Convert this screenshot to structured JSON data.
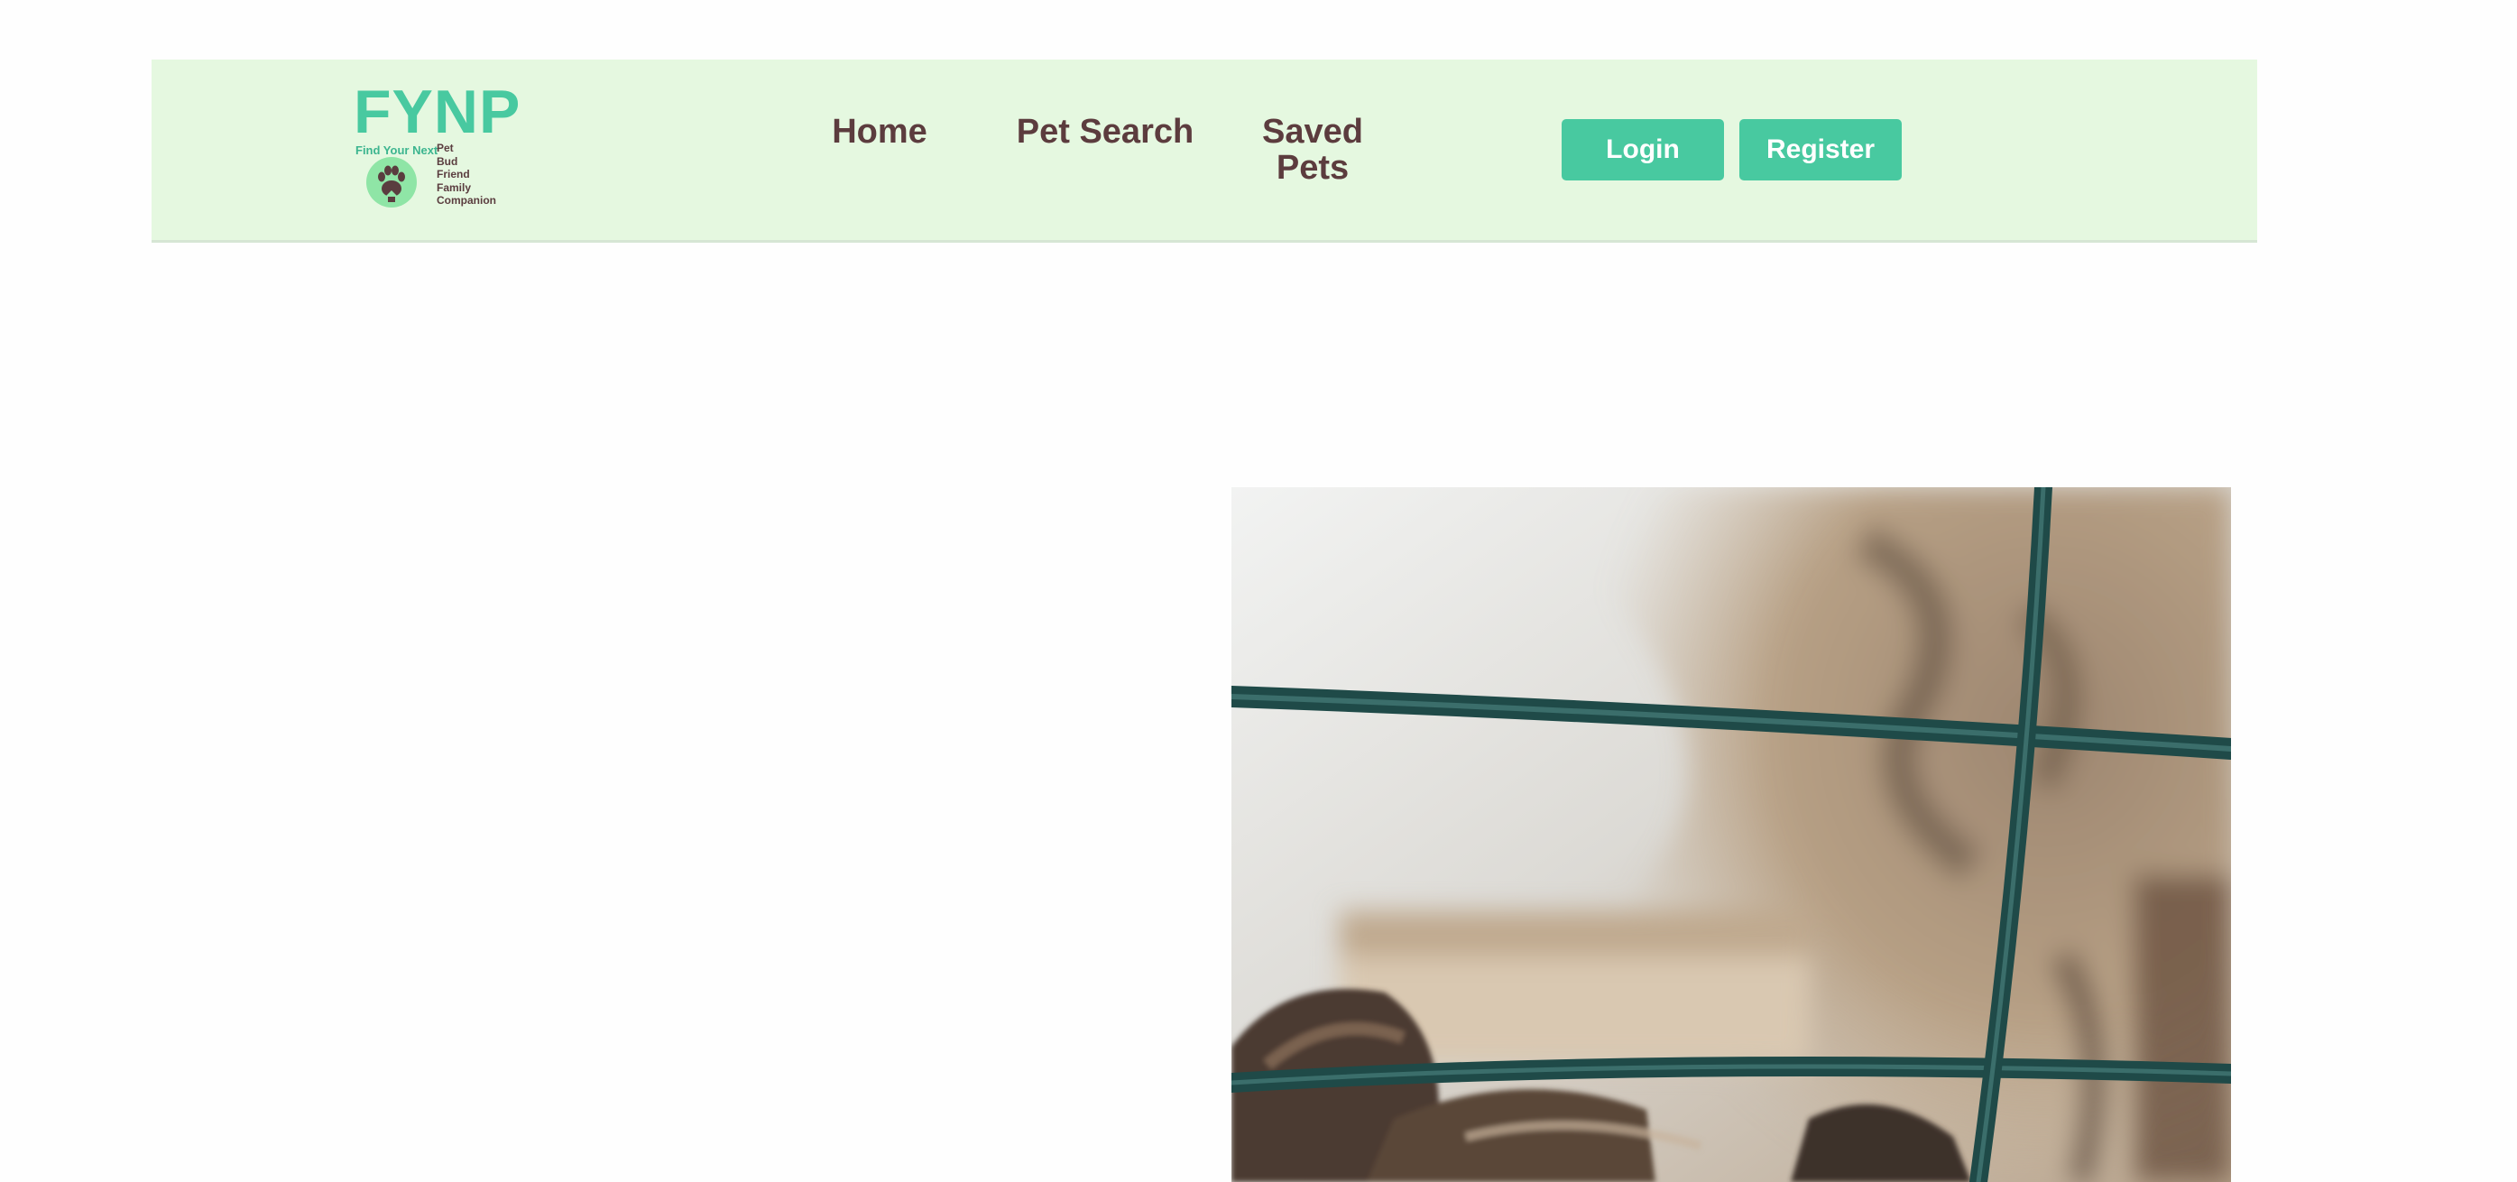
{
  "logo": {
    "title": "FYNP",
    "tagline": "Find Your Next",
    "words": [
      "Pet",
      "Bud",
      "Friend",
      "Family",
      "Companion"
    ]
  },
  "nav": {
    "home": "Home",
    "pet_search": "Pet Search",
    "saved_pets": "Saved Pets"
  },
  "auth": {
    "login": "Login",
    "register": "Register"
  },
  "colors": {
    "navbar_bg": "#e5f8e0",
    "accent": "#48c9a0",
    "nav_text": "#5c3c3e"
  },
  "hero": {
    "image_icon": "dog-behind-fence-photo"
  }
}
